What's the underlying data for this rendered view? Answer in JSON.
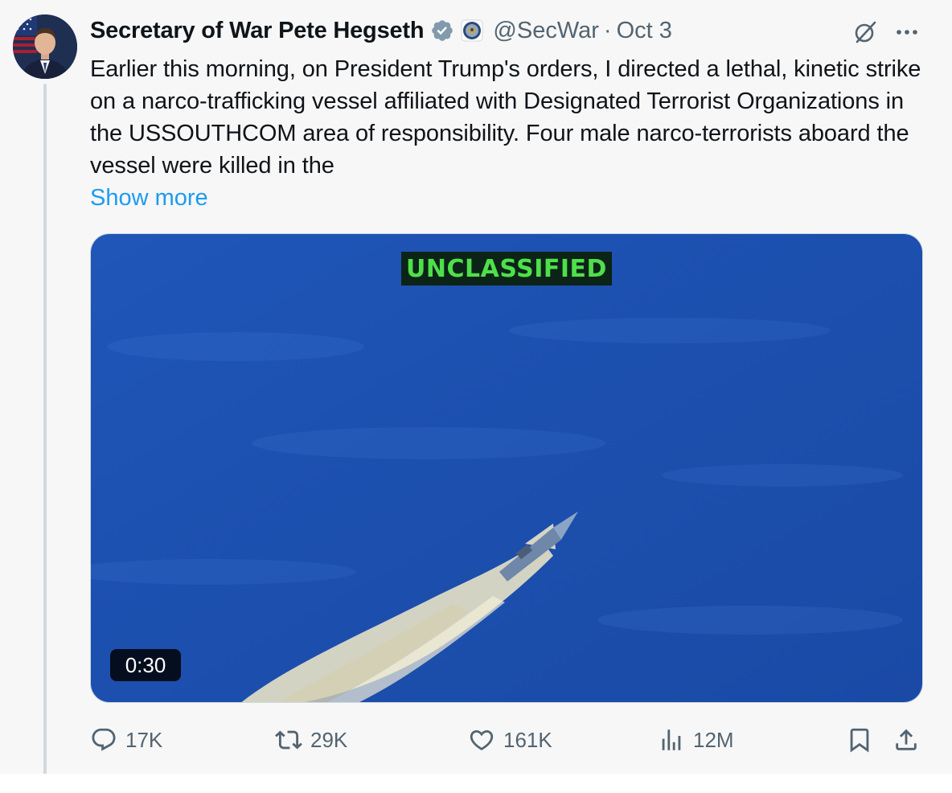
{
  "author": {
    "display_name": "Secretary of War Pete Hegseth",
    "handle": "@SecWar",
    "separator": "·",
    "date": "Oct 3"
  },
  "tweet": {
    "text": "Earlier this morning, on President Trump's orders, I directed a lethal, kinetic strike on a narco-trafficking vessel affiliated with Designated Terrorist Organizations in the USSOUTHCOM area of responsibility. Four male narco-terrorists aboard the vessel were killed in the",
    "show_more": "Show more"
  },
  "media": {
    "banner": "UNCLASSIFIED",
    "duration": "0:30"
  },
  "actions": {
    "replies": "17K",
    "reposts": "29K",
    "likes": "161K",
    "views": "12M"
  },
  "icons": {
    "verified": "verified-badge-icon",
    "affiliate": "dod-seal-icon",
    "grok": "grok-icon",
    "more": "more-icon",
    "reply": "reply-icon",
    "repost": "repost-icon",
    "like": "heart-icon",
    "views": "views-icon",
    "bookmark": "bookmark-icon",
    "share": "share-icon"
  },
  "colors": {
    "link": "#1d9bf0",
    "secondary_text": "#536471",
    "verified": "#829aab",
    "banner_text": "#4ee04a",
    "water": "#1d4fb0"
  }
}
